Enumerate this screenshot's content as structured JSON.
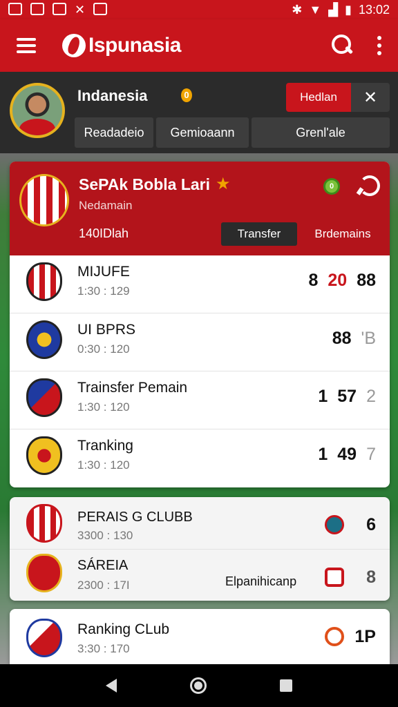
{
  "status_bar": {
    "time": "13:02"
  },
  "app": {
    "title": "Ispunasia"
  },
  "profile": {
    "name": "Indanesia",
    "coin_badge": "0",
    "action_label": "Hedlan",
    "close_glyph": "✕",
    "segments": [
      "Readadeio",
      "Gemioaann",
      "Grenl'ale"
    ]
  },
  "featured": {
    "title": "SePAk Bobla Lari",
    "subtitle": "Nedamain",
    "count": "140IDlah",
    "badge": "0",
    "tabs": [
      "Transfer",
      "Brdemains"
    ],
    "rows": [
      {
        "title": "MIJUFE",
        "time": "1:30 : 129",
        "scores": [
          "8",
          "20",
          "88"
        ],
        "crest_colors": [
          "#c8151c",
          "#ffffff"
        ]
      },
      {
        "title": "UI BPRS",
        "time": "0:30 : 120",
        "scores": [
          "88",
          "'B"
        ],
        "crest_colors": [
          "#1f3aa0",
          "#f0c020"
        ]
      },
      {
        "title": "Trainsfer Pemain",
        "time": "1:30 : 120",
        "scores": [
          "1",
          "57",
          "2"
        ],
        "crest_colors": [
          "#c8151c",
          "#1f3aa0"
        ]
      },
      {
        "title": "Tranking",
        "time": "1:30 : 120",
        "scores": [
          "1",
          "49",
          "7"
        ],
        "crest_colors": [
          "#f0c020",
          "#c8151c"
        ]
      }
    ]
  },
  "clubs_card": {
    "rows": [
      {
        "title": "PERAIS G CLUBB",
        "time": "3300 : 130",
        "value": "6"
      },
      {
        "title": "SÁREIA",
        "time": "2300 : 17I",
        "mid_text": "Elpanihicanp",
        "value": "8"
      }
    ]
  },
  "ranking_card": {
    "rows": [
      {
        "title": "Ranking CLub",
        "time": "3:30 : 170",
        "value": "1P"
      }
    ]
  }
}
